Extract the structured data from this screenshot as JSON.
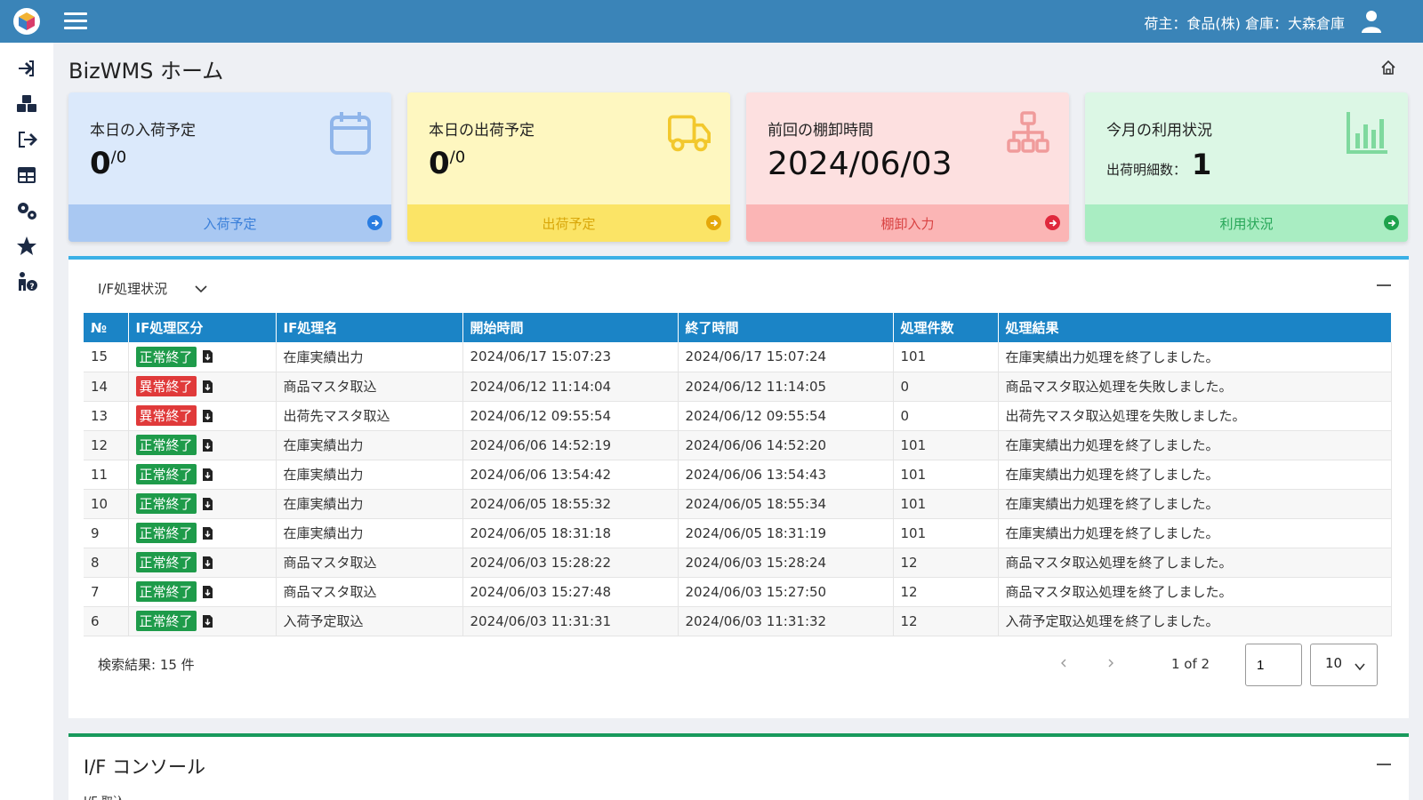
{
  "header": {
    "owner_text": "荷主：食品(株) 倉庫：大森倉庫"
  },
  "page": {
    "title": "BizWMS ホーム"
  },
  "cards": {
    "inbound": {
      "label": "本日の入荷予定",
      "value": "0",
      "total": "/0",
      "footer": "入荷予定",
      "color": "#dbe9fb"
    },
    "outbound": {
      "label": "本日の出荷予定",
      "value": "0",
      "total": "/0",
      "footer": "出荷予定",
      "color": "#fef7c0"
    },
    "inventory": {
      "label": "前回の棚卸時間",
      "value": "2024/06/03",
      "footer": "棚卸入力",
      "color": "#fde0e0"
    },
    "usage": {
      "label": "今月の利用状況",
      "sub_label": "出荷明細数：",
      "value": "1",
      "footer": "利用状況",
      "color": "#dcf7e5"
    }
  },
  "if_panel": {
    "title": "I/F処理状況",
    "columns": [
      "№",
      "IF処理区分",
      "IF処理名",
      "開始時間",
      "終了時間",
      "処理件数",
      "処理結果"
    ],
    "rows": [
      {
        "no": "15",
        "status": "正常終了",
        "ok": true,
        "name": "在庫実績出力",
        "start": "2024/06/17 15:07:23",
        "end": "2024/06/17 15:07:24",
        "count": "101",
        "result": "在庫実績出力処理を終了しました。"
      },
      {
        "no": "14",
        "status": "異常終了",
        "ok": false,
        "name": "商品マスタ取込",
        "start": "2024/06/12 11:14:04",
        "end": "2024/06/12 11:14:05",
        "count": "0",
        "result": "商品マスタ取込処理を失敗しました。"
      },
      {
        "no": "13",
        "status": "異常終了",
        "ok": false,
        "name": "出荷先マスタ取込",
        "start": "2024/06/12 09:55:54",
        "end": "2024/06/12 09:55:54",
        "count": "0",
        "result": "出荷先マスタ取込処理を失敗しました。"
      },
      {
        "no": "12",
        "status": "正常終了",
        "ok": true,
        "name": "在庫実績出力",
        "start": "2024/06/06 14:52:19",
        "end": "2024/06/06 14:52:20",
        "count": "101",
        "result": "在庫実績出力処理を終了しました。"
      },
      {
        "no": "11",
        "status": "正常終了",
        "ok": true,
        "name": "在庫実績出力",
        "start": "2024/06/06 13:54:42",
        "end": "2024/06/06 13:54:43",
        "count": "101",
        "result": "在庫実績出力処理を終了しました。"
      },
      {
        "no": "10",
        "status": "正常終了",
        "ok": true,
        "name": "在庫実績出力",
        "start": "2024/06/05 18:55:32",
        "end": "2024/06/05 18:55:34",
        "count": "101",
        "result": "在庫実績出力処理を終了しました。"
      },
      {
        "no": "9",
        "status": "正常終了",
        "ok": true,
        "name": "在庫実績出力",
        "start": "2024/06/05 18:31:18",
        "end": "2024/06/05 18:31:19",
        "count": "101",
        "result": "在庫実績出力処理を終了しました。"
      },
      {
        "no": "8",
        "status": "正常終了",
        "ok": true,
        "name": "商品マスタ取込",
        "start": "2024/06/03 15:28:22",
        "end": "2024/06/03 15:28:24",
        "count": "12",
        "result": "商品マスタ取込処理を終了しました。"
      },
      {
        "no": "7",
        "status": "正常終了",
        "ok": true,
        "name": "商品マスタ取込",
        "start": "2024/06/03 15:27:48",
        "end": "2024/06/03 15:27:50",
        "count": "12",
        "result": "商品マスタ取込処理を終了しました。"
      },
      {
        "no": "6",
        "status": "正常終了",
        "ok": true,
        "name": "入荷予定取込",
        "start": "2024/06/03 11:31:31",
        "end": "2024/06/03 11:31:32",
        "count": "12",
        "result": "入荷予定取込処理を終了しました。"
      }
    ],
    "result_count": "検索結果: 15 件",
    "pager_text": "1 of 2",
    "page_value": "1",
    "per_page": "10"
  },
  "console_panel": {
    "title": "I/F コンソール",
    "sub": "I/F 取込"
  },
  "colors": {
    "header": "#3a84b8",
    "table_header": "#1b84c6",
    "ok_badge": "#1e9b4a",
    "ng_badge": "#e03a3a"
  }
}
